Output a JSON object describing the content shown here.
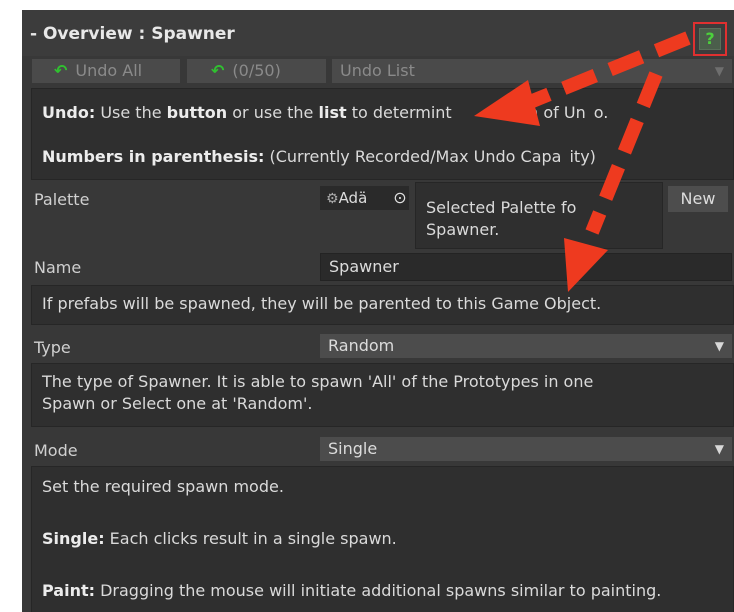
{
  "header": {
    "title": "- Overview : Spawner",
    "help_label": "?"
  },
  "undo": {
    "undo_all_label": "Undo All",
    "count_label": "(0/50)",
    "list_label": "Undo List"
  },
  "undo_help": {
    "line1_bold": "Undo:",
    "line1_a": " Use the ",
    "line1_b_bold": "button",
    "line1_c": " or use the ",
    "line1_d_bold": "list",
    "line1_e": " to determint",
    "line1_f": "depth of Un",
    "line1_g": "o.",
    "line2_bold": "Numbers in parenthesis:",
    "line2_a": " (Currently Recorded/Max Undo Capa",
    "line2_b": "ity)"
  },
  "palette": {
    "label": "Palette",
    "value": "Adä",
    "help_line1": "Selected Palette fo",
    "help_line2": "Spawner.",
    "new_label": "New"
  },
  "name": {
    "label": "Name",
    "value": "Spawner",
    "help": "If prefabs will be spawned, they will be parented to this Game Object."
  },
  "type": {
    "label": "Type",
    "value": "Random",
    "help_line1": "The type of Spawner. It is able to spawn 'All' of the Prototypes in one",
    "help_line2": "Spawn or Select one at 'Random'."
  },
  "mode": {
    "label": "Mode",
    "value": "Single",
    "help_line1": "Set the required spawn mode.",
    "help_single_bold": "Single:",
    "help_single": " Each clicks result in a single spawn.",
    "help_paint_bold": "Paint:",
    "help_paint": " Dragging the mouse will initiate additional spawns similar to painting."
  },
  "colors": {
    "panel_bg": "#383838",
    "help_bg": "#2f2f2f",
    "arrow_red": "#ee3a1f",
    "highlight_red": "#e03030",
    "help_icon_green": "#4cd13c"
  },
  "icons": {
    "undo": "undo-arrow-icon",
    "picker": "object-picker-icon",
    "palette": "palette-icon",
    "caret": "dropdown-caret-icon",
    "help": "help-question-icon"
  }
}
